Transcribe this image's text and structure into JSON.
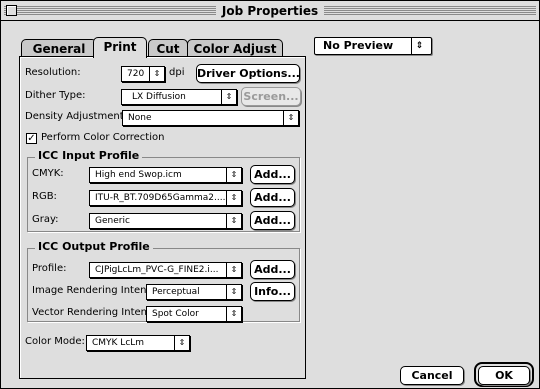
{
  "window": {
    "title": "Job Properties"
  },
  "tabs": [
    "General",
    "Print",
    "Cut",
    "Color Adjust"
  ],
  "preview": {
    "selected": "No Preview"
  },
  "print": {
    "resolution_label": "Resolution:",
    "resolution_value": "720",
    "resolution_unit": "dpi",
    "driver_options": "Driver Options...",
    "dither_label": "Dither Type:",
    "dither_value": "LX Diffusion",
    "screen_button": "Screen...",
    "density_label": "Density Adjustment:",
    "density_value": "None",
    "color_correction_label": "Perform Color Correction",
    "color_correction_checked": true,
    "icc_input": {
      "title": "ICC Input Profile",
      "cmyk_label": "CMYK:",
      "cmyk_value": "High end Swop.icm",
      "rgb_label": "RGB:",
      "rgb_value": "ITU-R_BT.709D65Gamma2....",
      "gray_label": "Gray:",
      "gray_value": "Generic",
      "add": "Add..."
    },
    "icc_output": {
      "title": "ICC Output Profile",
      "profile_label": "Profile:",
      "profile_value": "CJPigLcLm_PVC-G_FINE2.i...",
      "add": "Add...",
      "image_intent_label": "Image Rendering Intent:",
      "image_intent_value": "Perceptual",
      "info": "Info...",
      "vector_intent_label": "Vector Rendering Intent:",
      "vector_intent_value": "Spot Color"
    },
    "color_mode_label": "Color Mode:",
    "color_mode_value": "CMYK LcLm"
  },
  "buttons": {
    "cancel": "Cancel",
    "ok": "OK"
  },
  "icons": {
    "popup_arrow": "⇕",
    "checkmark": "✓"
  }
}
